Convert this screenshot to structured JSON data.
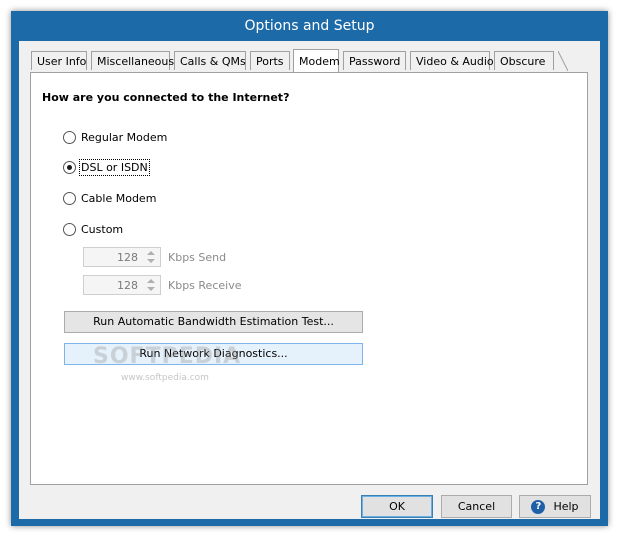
{
  "window": {
    "title": "Options and Setup"
  },
  "tabs": [
    {
      "label": "User Info",
      "active": false
    },
    {
      "label": "Miscellaneous",
      "active": false
    },
    {
      "label": "Calls & QMs",
      "active": false
    },
    {
      "label": "Ports",
      "active": false
    },
    {
      "label": "Modem",
      "active": true
    },
    {
      "label": "Password",
      "active": false
    },
    {
      "label": "Video & Audio",
      "active": false
    },
    {
      "label": "Obscure",
      "active": false
    }
  ],
  "modem": {
    "question": "How are you connected to the Internet?",
    "options": [
      {
        "label": "Regular Modem",
        "checked": false
      },
      {
        "label": "DSL or ISDN",
        "checked": true
      },
      {
        "label": "Cable Modem",
        "checked": false
      },
      {
        "label": "Custom",
        "checked": false
      }
    ],
    "send": {
      "value": "128",
      "label": "Kbps Send"
    },
    "receive": {
      "value": "128",
      "label": "Kbps Receive"
    },
    "bandwidth_button": "Run Automatic Bandwidth Estimation Test...",
    "diagnostics_button": "Run Network Diagnostics..."
  },
  "watermark": {
    "text": "SOFTPEDIA",
    "url": "www.softpedia.com"
  },
  "footer": {
    "ok": "OK",
    "cancel": "Cancel",
    "help": "Help"
  },
  "colors": {
    "titlebar": "#1c6aa8",
    "client": "#f0f0f0",
    "panel": "#ffffff",
    "accent": "#1f5fa8"
  }
}
